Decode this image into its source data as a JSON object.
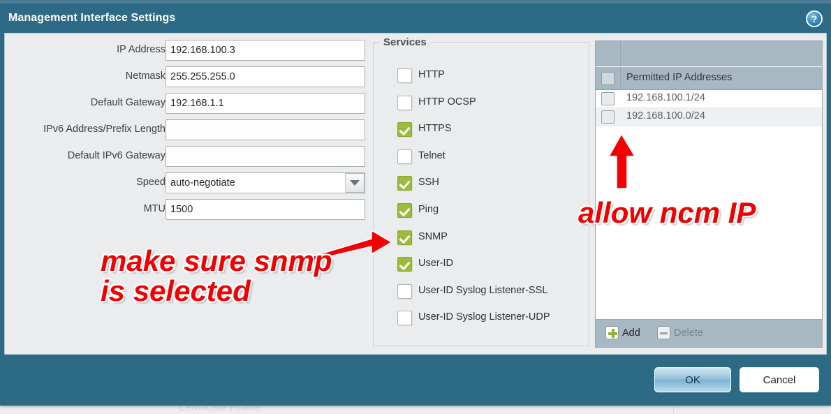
{
  "window": {
    "title": "Management Interface Settings",
    "help_icon": "help-circle-icon"
  },
  "form": {
    "fields": [
      {
        "label": "IP Address",
        "value": "192.168.100.3",
        "type": "text"
      },
      {
        "label": "Netmask",
        "value": "255.255.255.0",
        "type": "text"
      },
      {
        "label": "Default Gateway",
        "value": "192.168.1.1",
        "type": "text"
      },
      {
        "label": "IPv6 Address/Prefix Length",
        "value": "",
        "type": "text"
      },
      {
        "label": "Default IPv6 Gateway",
        "value": "",
        "type": "text"
      },
      {
        "label": "Speed",
        "value": "auto-negotiate",
        "type": "select"
      },
      {
        "label": "MTU",
        "value": "1500",
        "type": "text"
      }
    ]
  },
  "services": {
    "legend": "Services",
    "items": [
      {
        "label": "HTTP",
        "checked": false
      },
      {
        "label": "HTTP OCSP",
        "checked": false
      },
      {
        "label": "HTTPS",
        "checked": true
      },
      {
        "label": "Telnet",
        "checked": false
      },
      {
        "label": "SSH",
        "checked": true
      },
      {
        "label": "Ping",
        "checked": true
      },
      {
        "label": "SNMP",
        "checked": true
      },
      {
        "label": "User-ID",
        "checked": true
      },
      {
        "label": "User-ID Syslog Listener-SSL",
        "checked": false
      },
      {
        "label": "User-ID Syslog Listener-UDP",
        "checked": false
      }
    ]
  },
  "permitted_ip": {
    "column_header": "Permitted IP Addresses",
    "rows": [
      {
        "value": "192.168.100.1/24",
        "checked": false
      },
      {
        "value": "192.168.100.0/24",
        "checked": false
      }
    ],
    "toolbar": {
      "add_label": "Add",
      "delete_label": "Delete"
    }
  },
  "footer": {
    "ok_label": "OK",
    "cancel_label": "Cancel"
  },
  "annotations": {
    "snmp_note": "make sure snmp\nis selected",
    "ncm_note": "allow ncm IP",
    "color": "#f20000"
  },
  "background": {
    "faint_label": "Certificate Profile"
  }
}
